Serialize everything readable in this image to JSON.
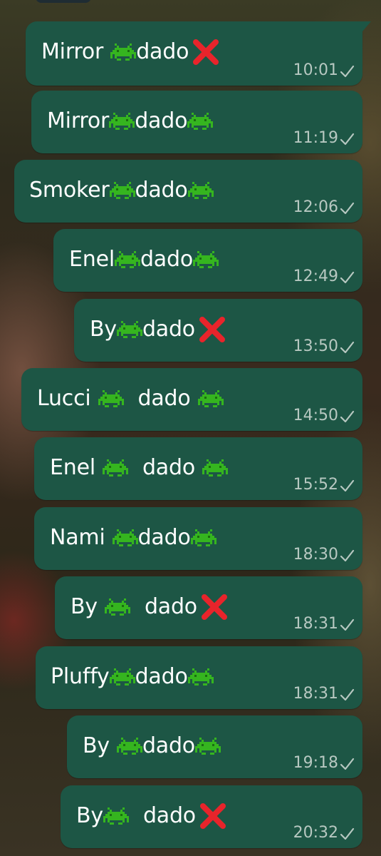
{
  "chat": {
    "messages": [
      {
        "name": "Mirror",
        "middle": "alien-monster",
        "word": "dado",
        "end": "cross-mark",
        "time": "10:01"
      },
      {
        "name": "Mirror",
        "middle": "alien-monster",
        "word": "dado",
        "end": "alien-monster",
        "time": "11:19"
      },
      {
        "name": "Smoker",
        "middle": "alien-monster",
        "word": "dado",
        "end": "alien-monster",
        "time": "12:06"
      },
      {
        "name": "Enel",
        "middle": "alien-monster",
        "word": "dado",
        "end": "alien-monster",
        "time": "12:49"
      },
      {
        "name": "By",
        "middle": "alien-monster",
        "word": "dado",
        "end": "cross-mark",
        "time": "13:50"
      },
      {
        "name": "Lucci",
        "middle": "alien-monster",
        "word": "dado",
        "end": "alien-monster",
        "time": "14:50"
      },
      {
        "name": "Enel",
        "middle": "alien-monster",
        "word": "dado",
        "end": "alien-monster",
        "time": "15:52"
      },
      {
        "name": "Nami",
        "middle": "alien-monster",
        "word": "dado",
        "end": "alien-monster",
        "time": "18:30"
      },
      {
        "name": "By",
        "middle": "alien-monster",
        "word": "dado",
        "end": "cross-mark",
        "time": "18:31"
      },
      {
        "name": "Pluffy",
        "middle": "alien-monster",
        "word": "dado",
        "end": "alien-monster",
        "time": "18:31"
      },
      {
        "name": "By",
        "middle": "alien-monster",
        "word": "dado",
        "end": "alien-monster",
        "time": "19:18"
      },
      {
        "name": "By",
        "middle": "alien-monster",
        "word": "dado",
        "end": "cross-mark",
        "time": "20:32"
      }
    ],
    "status_icon": "single-check-icon"
  },
  "colors": {
    "bubble": "#1d5645",
    "text": "#ffffff",
    "meta": "#b7c8c1",
    "invader": "#35b51f",
    "cross": "#e8242b"
  }
}
